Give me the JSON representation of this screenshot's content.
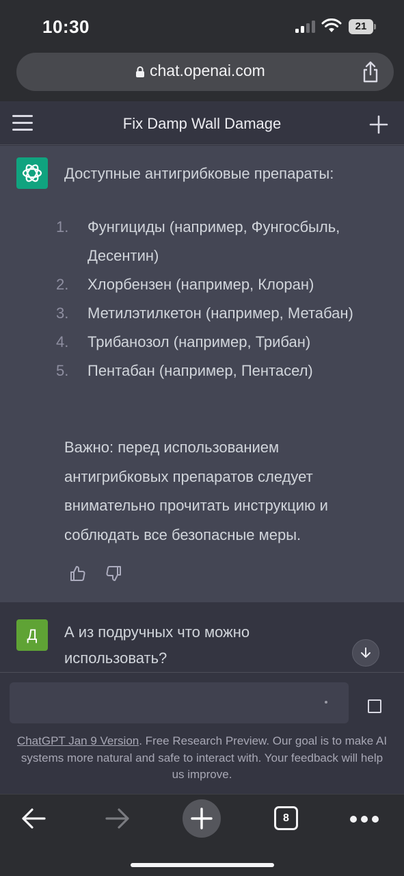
{
  "status_bar": {
    "time": "10:30",
    "battery": "21",
    "icons": [
      "cellular-signal-icon",
      "wifi-icon",
      "battery-icon"
    ]
  },
  "browser": {
    "url": "chat.openai.com",
    "tab_count": "8",
    "icons": [
      "lock-icon",
      "share-icon",
      "back-icon",
      "forward-icon",
      "new-tab-plus-icon",
      "tabs-icon",
      "more-icon"
    ]
  },
  "header": {
    "title": "Fix Damp Wall Damage",
    "icons": [
      "menu-icon",
      "new-chat-plus-icon"
    ]
  },
  "assistant_message": {
    "intro": "Доступные антигрибковые препараты:",
    "items": [
      {
        "num": "1.",
        "text": "Фунгициды (например, Фунгосбыль, Десентин)"
      },
      {
        "num": "2.",
        "text": "Хлорбензен (например, Клоран)"
      },
      {
        "num": "3.",
        "text": "Метилэтилкетон (например, Метабан)"
      },
      {
        "num": "4.",
        "text": "Трибанозол (например, Трибан)"
      },
      {
        "num": "5.",
        "text": "Пентабан (например, Пентасел)"
      }
    ],
    "note": "Важно: перед использованием антигрибковых препаратов следует внимательно прочитать инструкцию и соблюдать все безопасные меры."
  },
  "user_message": {
    "avatar_letter": "Д",
    "text": "А из подручных что можно использовать?"
  },
  "composer": {
    "placeholder": ""
  },
  "footer": {
    "link": "ChatGPT Jan 9 Version",
    "text": ". Free Research Preview. Our goal is to make AI systems more natural and safe to interact with. Your feedback will help us improve."
  },
  "colors": {
    "accent": "#10a37f",
    "user_avatar": "#5fa335",
    "assistant_bg": "#444654",
    "page_bg": "#343541"
  }
}
